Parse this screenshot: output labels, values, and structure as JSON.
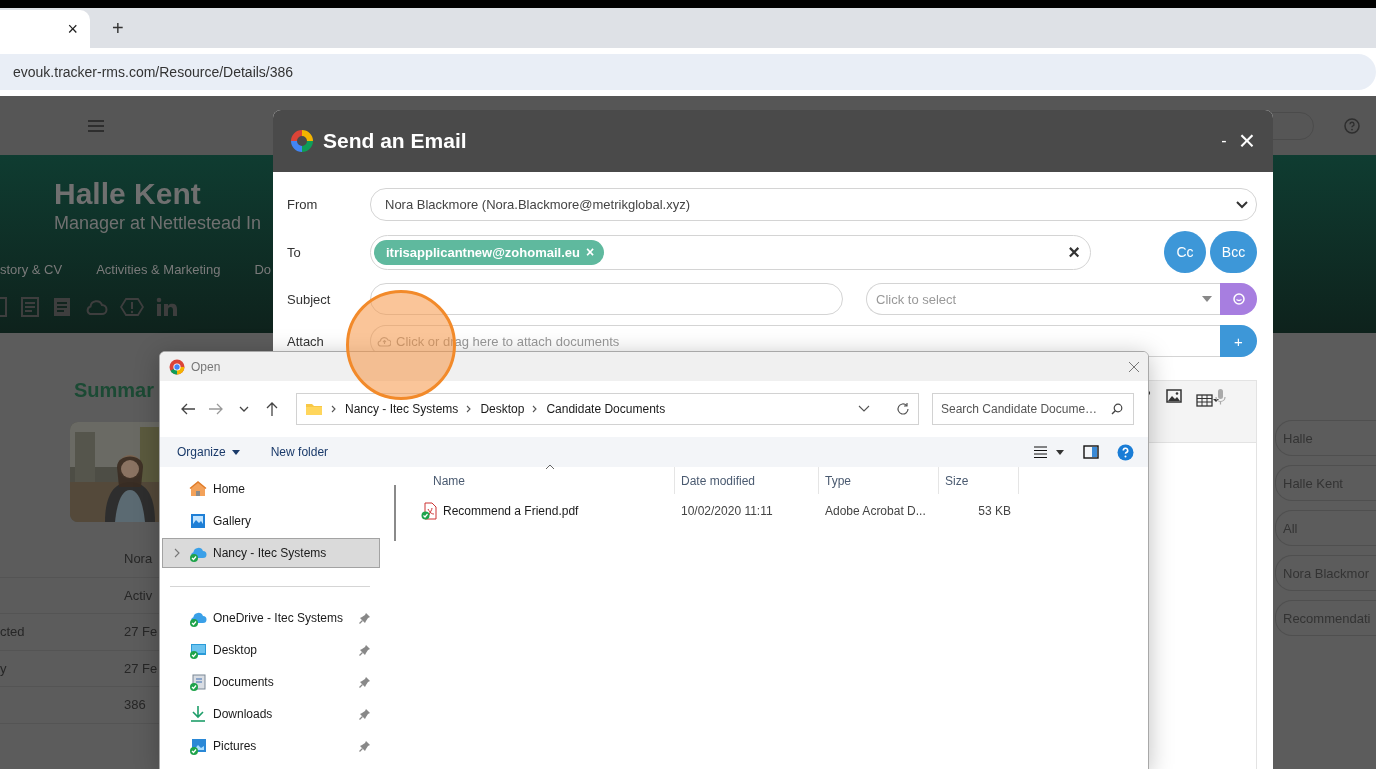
{
  "browser": {
    "tab_close": "×",
    "new_tab": "+",
    "url": "evouk.tracker-rms.com/Resource/Details/386"
  },
  "page": {
    "name": "Halle Kent",
    "headline": "Manager at Nettlestead In",
    "nav": [
      {
        "label": "story & CV"
      },
      {
        "label": "Activities & Marketing"
      },
      {
        "label": "Do"
      }
    ],
    "summary_title": "Summar",
    "summary_rows": [
      {
        "value": "Nora"
      },
      {
        "value": "Activ"
      },
      {
        "label": "cted",
        "value": "27 Fe"
      },
      {
        "label": "y",
        "value": "27 Fe"
      },
      {
        "value": "386"
      }
    ],
    "filters": [
      "Halle",
      "Halle Kent",
      "All",
      "Nora Blackmor",
      "Recommendati"
    ]
  },
  "email": {
    "title": "Send an Email",
    "minimize": "-",
    "close": "×",
    "from": {
      "label": "From",
      "value": "Nora Blackmore (Nora.Blackmore@metrikglobal.xyz)"
    },
    "to": {
      "label": "To",
      "recipients": [
        {
          "address": "itrisapplicantnew@zohomail.eu",
          "remove": "×"
        }
      ],
      "clear": "×"
    },
    "cc": "Cc",
    "bcc": "Bcc",
    "subject": {
      "label": "Subject",
      "template_placeholder": "Click to select"
    },
    "attach": {
      "label": "Attach",
      "placeholder": "Click or drag here to attach documents",
      "add": "+"
    }
  },
  "dialog": {
    "title": "Open",
    "breadcrumb": [
      "Nancy - Itec Systems",
      "Desktop",
      "Candidate Documents"
    ],
    "search_placeholder": "Search Candidate Docume…",
    "organize": "Organize",
    "new_folder": "New folder",
    "locations": [
      {
        "label": "Home",
        "kind": "home",
        "selected": false,
        "expandable": false
      },
      {
        "label": "Gallery",
        "kind": "gallery",
        "selected": false,
        "expandable": false
      },
      {
        "label": "Nancy - Itec Systems",
        "kind": "cloud",
        "selected": true,
        "expandable": true
      }
    ],
    "pinned": [
      {
        "label": "OneDrive - Itec Systems",
        "kind": "cloud",
        "pinned": true
      },
      {
        "label": "Desktop",
        "kind": "desktop",
        "pinned": true
      },
      {
        "label": "Documents",
        "kind": "documents",
        "pinned": true
      },
      {
        "label": "Downloads",
        "kind": "downloads",
        "pinned": true
      },
      {
        "label": "Pictures",
        "kind": "pictures",
        "pinned": true
      }
    ],
    "columns": [
      "Name",
      "Date modified",
      "Type",
      "Size"
    ],
    "files": [
      {
        "name": "Recommend a Friend.pdf",
        "modified": "10/02/2020 11:11",
        "type": "Adobe Acrobat D...",
        "size": "53 KB"
      }
    ]
  }
}
